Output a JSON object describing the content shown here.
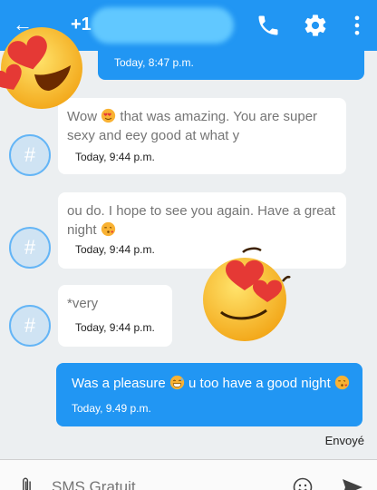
{
  "header": {
    "back_icon": "arrow-left-icon",
    "title": "+1",
    "actions": [
      "phone-icon",
      "gear-icon",
      "more-vert-icon"
    ],
    "color": "#2196f3"
  },
  "messages": [
    {
      "direction": "out",
      "time": "Today, 8:47 p.m."
    },
    {
      "direction": "in",
      "text_before": "Wow",
      "emoji": "heart-eyes-emoji",
      "text_after": "that was amazing. You are super sexy and eey good at what y",
      "time": "Today, 9:44 p.m."
    },
    {
      "direction": "in",
      "text": "ou do. I hope to see you again. Have a great night",
      "emoji": "kiss-emoji",
      "time": "Today, 9:44 p.m."
    },
    {
      "direction": "in",
      "text": "*very",
      "time": "Today, 9:44 p.m."
    },
    {
      "direction": "out",
      "text_before": "Was a pleasure",
      "emoji1": "grin-sweat-emoji",
      "text_middle": "u too have a good night",
      "emoji2": "kiss-emoji",
      "time": "Today, 9.49 p.m."
    }
  ],
  "avatar_glyph": "#",
  "status": "Envoyé",
  "composer": {
    "attach_icon": "paperclip-icon",
    "placeholder": "SMS Gratuit",
    "emoji_icon": "smiley-icon",
    "send_icon": "send-icon"
  },
  "stickers": [
    "heart-eyes-sticker",
    "heart-eyes-sticker"
  ]
}
